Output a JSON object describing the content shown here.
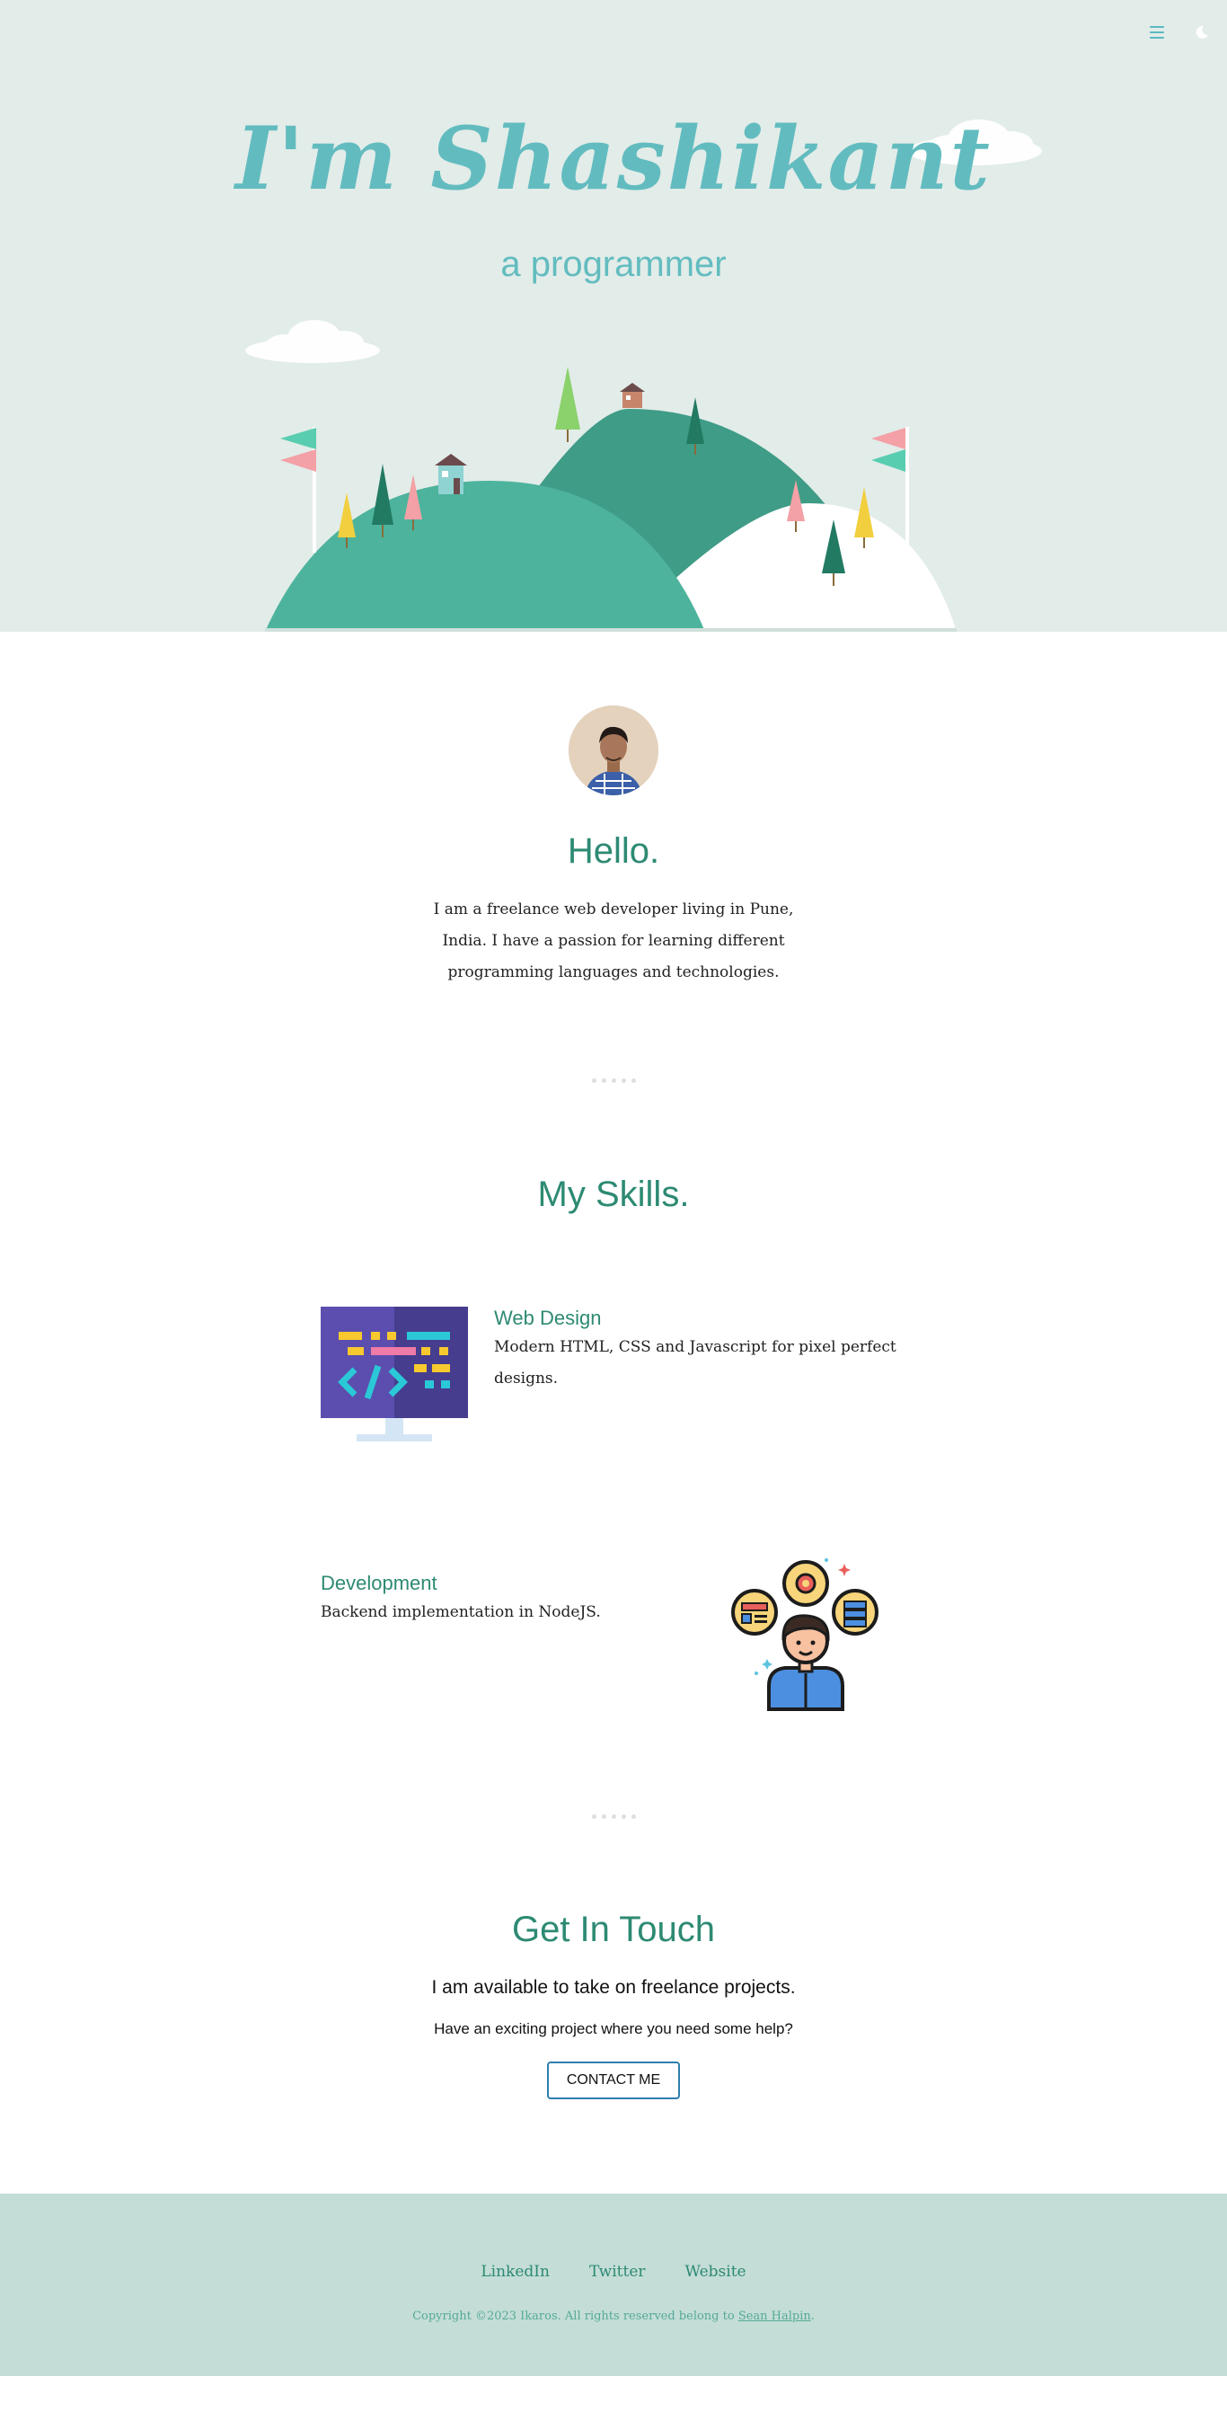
{
  "header": {
    "menu_icon": "hamburger-menu-icon",
    "theme_icon": "moon-icon"
  },
  "hero": {
    "title": "I'm Shashikant",
    "subtitle": "a programmer"
  },
  "about": {
    "heading": "Hello.",
    "text": "I am a freelance web developer living in Pune, India. I have a passion for learning different programming languages and technologies."
  },
  "skills": {
    "heading": "My Skills.",
    "items": [
      {
        "title": "Web Design",
        "desc": "Modern HTML, CSS and Javascript for pixel perfect designs.",
        "icon": "code-monitor-icon"
      },
      {
        "title": "Development",
        "desc": "Backend implementation in NodeJS.",
        "icon": "developer-icon"
      }
    ]
  },
  "contact": {
    "heading": "Get In Touch",
    "lead": "I am available to take on freelance projects.",
    "sub": "Have an exciting project where you need some help?",
    "button": "CONTACT ME"
  },
  "footer": {
    "links": [
      "LinkedIn",
      "Twitter",
      "Website"
    ],
    "copyright_prefix": "Copyright ©2023 Ikaros. All rights reserved belong to",
    "copyright_link": "Sean Halpin",
    "copyright_suffix": "."
  },
  "colors": {
    "hero_bg": "#e2ece9",
    "accent": "#62bcbf",
    "heading": "#2d8a73",
    "footer_bg": "#c4ddd7"
  }
}
